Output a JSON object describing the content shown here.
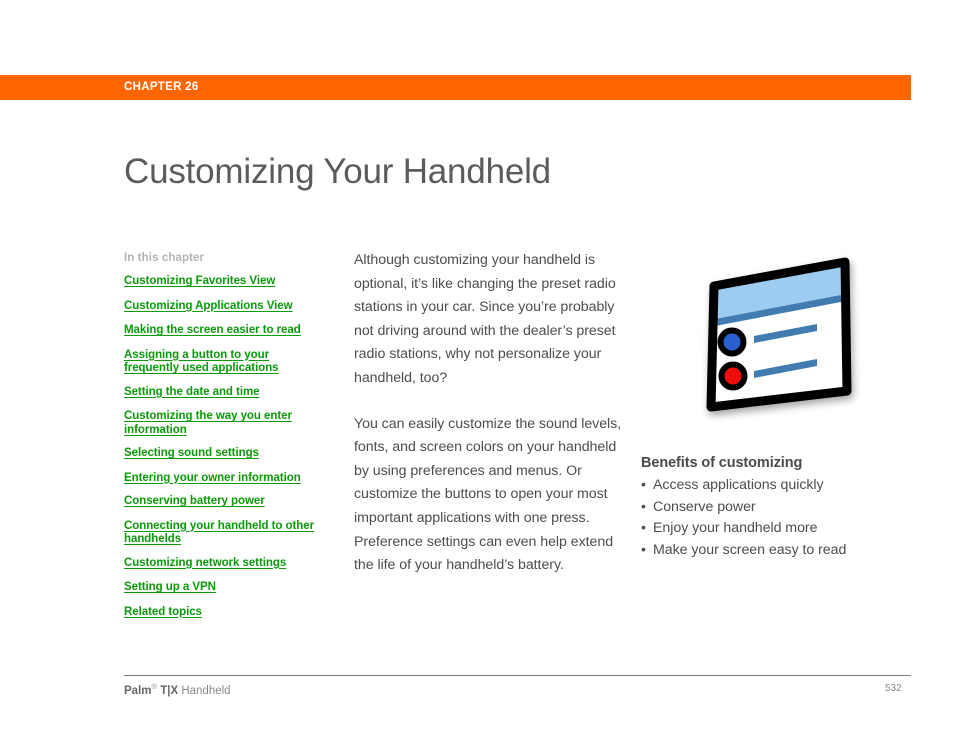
{
  "document": {
    "chapter_label": "CHAPTER 26",
    "title": "Customizing Your Handheld",
    "accent_color": "#ff6600",
    "link_color": "#0a9a0a",
    "title_color": "#5b5b5b"
  },
  "sidebar": {
    "heading": "In this chapter",
    "items": [
      {
        "label": "Customizing Favorites View"
      },
      {
        "label": "Customizing Applications View"
      },
      {
        "label": "Making the screen easier to read"
      },
      {
        "label": "Assigning a button to your frequently used applications"
      },
      {
        "label": "Setting the date and time"
      },
      {
        "label": "Customizing the way you enter information"
      },
      {
        "label": "Selecting sound settings"
      },
      {
        "label": "Entering your owner information"
      },
      {
        "label": "Conserving battery power"
      },
      {
        "label": "Connecting your handheld to other handhelds"
      },
      {
        "label": "Customizing network settings"
      },
      {
        "label": "Setting up a VPN"
      },
      {
        "label": "Related topics"
      }
    ]
  },
  "main": {
    "paragraphs": [
      "Although customizing your handheld is optional, it’s like changing the preset radio stations in your car. Since you’re probably not driving around with the dealer’s preset radio stations, why not personalize your handheld, too?",
      "You can easily customize the sound levels, fonts, and screen colors on your handheld by using preferences and menus. Or customize the buttons to open your most important applications with one press. Preference settings can even help extend the life of your handheld’s battery."
    ]
  },
  "benefits": {
    "title": "Benefits of customizing",
    "items": [
      "Access applications quickly",
      "Conserve power",
      "Enjoy your handheld more",
      "Make your screen easy to read"
    ]
  },
  "illustration": {
    "name": "preferences-dialog-illustration",
    "header_color": "#9ecbf0",
    "divider_color": "#3f7cb0",
    "line_color": "#3f7cb0",
    "radio_blue": "#2a5fd0",
    "radio_red": "#ee1111",
    "outline_color": "#000000",
    "body_color": "#ffffff"
  },
  "footer": {
    "brand": "Palm",
    "registered": "®",
    "model": " T|X",
    "suffix": " Handheld",
    "page_number": "532"
  }
}
